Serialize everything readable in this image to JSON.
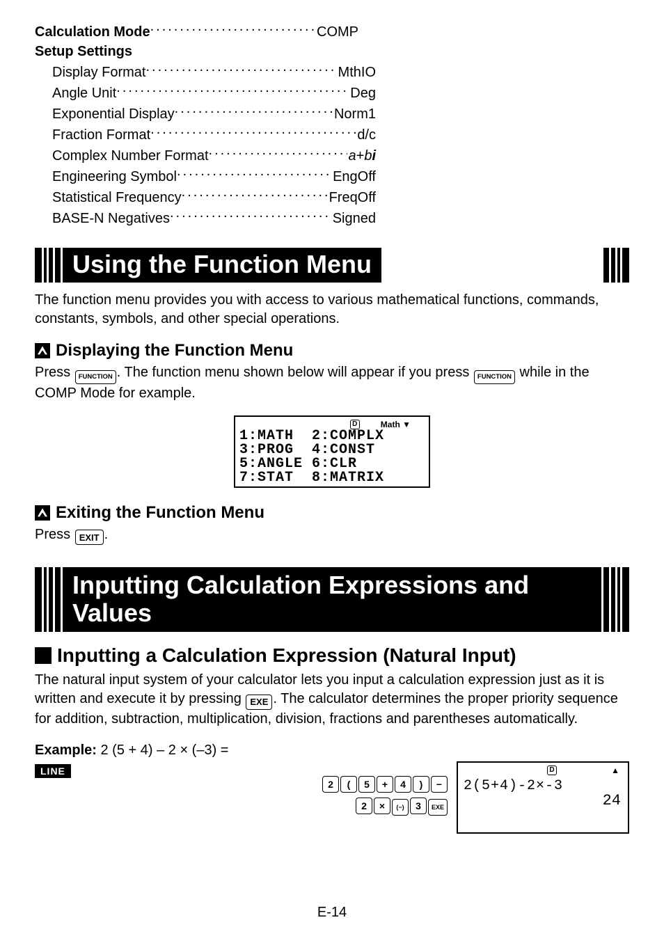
{
  "settings": {
    "calc_mode_label": "Calculation Mode",
    "calc_mode_value": "COMP",
    "setup_header": "Setup Settings",
    "rows": [
      {
        "label": "Display Format",
        "value": "MthIO"
      },
      {
        "label": "Angle Unit",
        "value": "Deg"
      },
      {
        "label": "Exponential Display",
        "value": "Norm1"
      },
      {
        "label": "Fraction Format",
        "value": "d/c"
      },
      {
        "label": "Complex Number Format",
        "value": "a+bi",
        "italic": true
      },
      {
        "label": "Engineering Symbol",
        "value": "EngOff"
      },
      {
        "label": "Statistical Frequency",
        "value": "FreqOff"
      },
      {
        "label": "BASE-N Negatives",
        "value": "Signed"
      }
    ]
  },
  "section1": {
    "title": "Using the Function Menu",
    "intro": "The function menu provides you with access to various mathematical functions, commands, constants, symbols, and other special operations.",
    "sub1": "Displaying the Function Menu",
    "sub1_text_a": "Press ",
    "sub1_key1": "FUNCTION",
    "sub1_text_b": ". The function menu shown below will appear if you press ",
    "sub1_key2": "FUNCTION",
    "sub1_text_c": " while in the COMP Mode for example.",
    "sub2": "Exiting the Function Menu",
    "sub2_text_a": "Press ",
    "sub2_key": "EXIT",
    "sub2_text_b": "."
  },
  "lcd_menu": {
    "status_d": "D",
    "status_math": "Math ▼",
    "rows": [
      {
        "l": "1:MATH",
        "r": "2:COMPLX"
      },
      {
        "l": "3:PROG",
        "r": "4:CONST"
      },
      {
        "l": "5:ANGLE",
        "r": "6:CLR"
      },
      {
        "l": "7:STAT",
        "r": "8:MATRIX"
      }
    ]
  },
  "section2": {
    "title": "Inputting Calculation Expressions and Values",
    "sub": "Inputting a Calculation Expression (Natural Input)",
    "para_a": "The natural input system of your calculator lets you input a calculation expression just as it is written and execute it by pressing ",
    "exe_key": "EXE",
    "para_b": ". The calculator determines the proper priority sequence for addition, subtraction, multiplication, division, fractions and parentheses automatically.",
    "example_label": "Example:",
    "example_expr": " 2 (5 + 4) – 2 × (–3) =",
    "line_badge": "LINE"
  },
  "keyseq": {
    "row1": [
      "2",
      "(",
      "5",
      "+",
      "4",
      ")",
      "−"
    ],
    "row2": [
      "2",
      "×",
      "(−)",
      "3",
      "EXE"
    ]
  },
  "lcd_result": {
    "status_d": "D",
    "status_arrow": "▲",
    "expr": "2(5+4)-2×-3",
    "result": "24"
  },
  "page_number": "E-14"
}
